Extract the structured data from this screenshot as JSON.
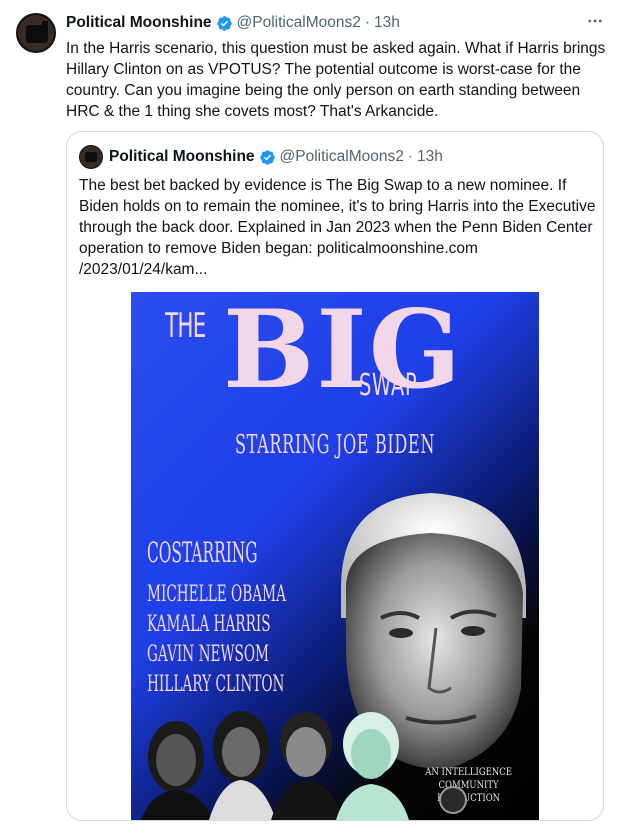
{
  "tweet": {
    "display_name": "Political Moonshine",
    "handle": "@PoliticalMoons2",
    "separator": "·",
    "time": "13h",
    "text": "In the Harris scenario, this question must be asked again. What if Harris brings Hillary Clinton on as VPOTUS? The potential outcome is worst-case for the country. Can you imagine being the only person on earth standing between HRC & the 1 thing she covets most? That's Arkancide."
  },
  "quoted_tweet": {
    "display_name": "Political Moonshine",
    "handle": "@PoliticalMoons2",
    "separator": "·",
    "time": "13h",
    "text": "The best bet backed by evidence is The Big Swap to a new nominee. If Biden holds on to remain the nominee,  it's to bring Harris into the Executive through the back door. Explained in Jan 2023 when the Penn Biden Center operation to remove Biden began: politicalmoonshine.com /2023/01/24/kam..."
  },
  "poster": {
    "the": "THE",
    "big": "BIG",
    "swap": "SWAP",
    "starring": "STARRING JOE BIDEN",
    "costarring": "COSTARRING",
    "cast": [
      "MICHELLE OBAMA",
      "KAMALA HARRIS",
      "GAVIN NEWSOM",
      "HILLARY CLINTON"
    ],
    "credit_line1": "AN INTELLIGENCE COMMUNITY",
    "credit_line2": "PRODUCTION"
  },
  "icons": {
    "verified": "verified-badge-icon",
    "more": "more-options-icon"
  },
  "colors": {
    "verified_blue": "#1d9bf0",
    "secondary_text": "#536471",
    "poster_title_pink": "#f4d6ea",
    "poster_blue": "#2a4cf0"
  }
}
